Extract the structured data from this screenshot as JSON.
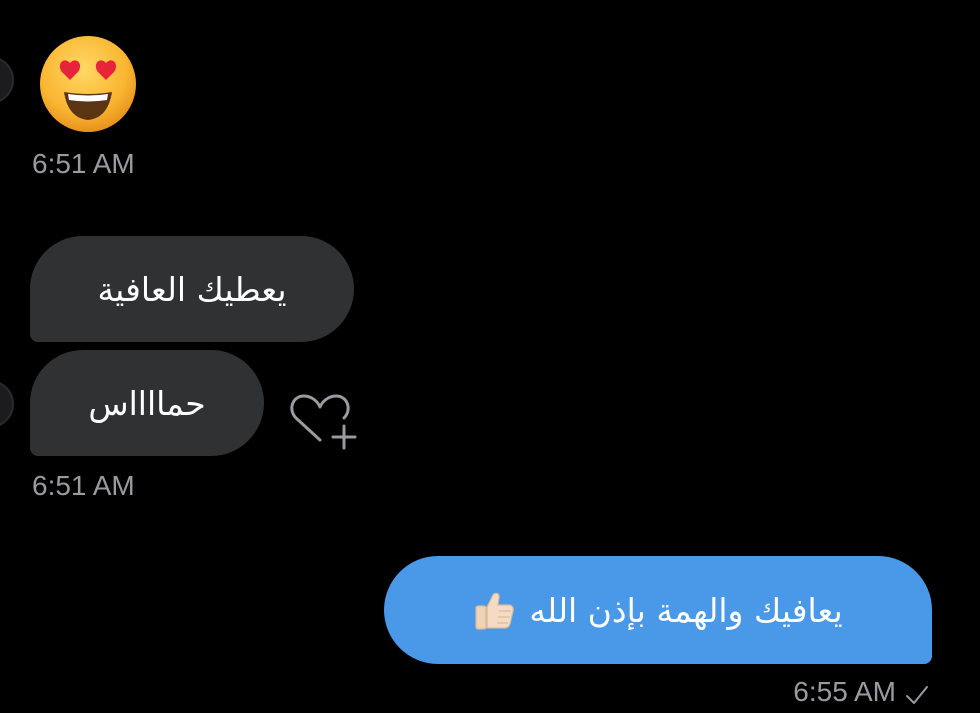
{
  "messages": [
    {
      "direction": "incoming",
      "emoji": "heart-eyes-emoji"
    },
    {
      "direction": "incoming",
      "timestamp": "6:51 AM"
    },
    {
      "direction": "incoming",
      "text": "يعطيك العافية"
    },
    {
      "direction": "incoming",
      "text": "حمااااس"
    },
    {
      "direction": "incoming",
      "timestamp": "6:51 AM"
    },
    {
      "direction": "outgoing",
      "text": "يعافيك والهمة بإذن الله",
      "emoji": "thumbs-up-emoji"
    },
    {
      "direction": "outgoing",
      "timestamp": "6:55 AM",
      "status_icon": "check-icon"
    }
  ],
  "colors": {
    "background": "#000000",
    "incoming_bubble": "#2f3133",
    "outgoing_bubble": "#4a99e9",
    "timestamp": "#9a9aa0"
  },
  "icons": [
    "heart-eyes-emoji",
    "heart-plus-icon",
    "thumbs-up-emoji",
    "check-icon"
  ]
}
